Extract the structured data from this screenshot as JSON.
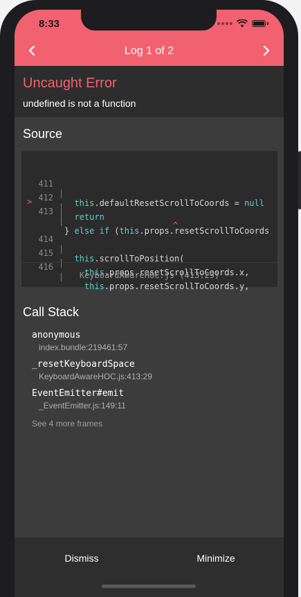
{
  "status_bar": {
    "time": "8:33"
  },
  "header": {
    "title": "Log 1 of 2",
    "prev_icon": "chevron-left-icon",
    "next_icon": "chevron-right-icon"
  },
  "error": {
    "title": "Uncaught Error",
    "message": "undefined is not a function"
  },
  "source": {
    "title": "Source",
    "lines": [
      {
        "marker": "",
        "number": "411",
        "gutter": "|",
        "code": "  this.defaultResetScrollToCoords = null"
      },
      {
        "marker": "",
        "number": "412",
        "gutter": "|",
        "code": "  return"
      },
      {
        "marker": ">",
        "number": "413",
        "gutter": "|",
        "code": "} else if (this.props.resetScrollToCoords"
      },
      {
        "marker": "",
        "number": "",
        "gutter": "|",
        "code": "",
        "caret": "^"
      },
      {
        "marker": "",
        "number": "414",
        "gutter": "|",
        "code": "  this.scrollToPosition("
      },
      {
        "marker": "",
        "number": "415",
        "gutter": "|",
        "code": "    this.props.resetScrollToCoords.x,"
      },
      {
        "marker": "",
        "number": "416",
        "gutter": "|",
        "code": "    this.props.resetScrollToCoords.y,"
      }
    ],
    "file": "KeyboardAwareHOC.js (413:29)"
  },
  "call_stack": {
    "title": "Call Stack",
    "frames": [
      {
        "function": "anonymous",
        "location": "index.bundle:219461:57"
      },
      {
        "function": "_resetKeyboardSpace",
        "location": "KeyboardAwareHOC.js:413:29"
      },
      {
        "function": "EventEmitter#emit",
        "location": "_EventEmitter.js:149:11"
      }
    ],
    "more": "See 4 more frames"
  },
  "footer": {
    "dismiss": "Dismiss",
    "minimize": "Minimize"
  },
  "colors": {
    "accent": "#f2616f",
    "keyword": "#5fd2c8",
    "background": "#3c3c3c"
  }
}
